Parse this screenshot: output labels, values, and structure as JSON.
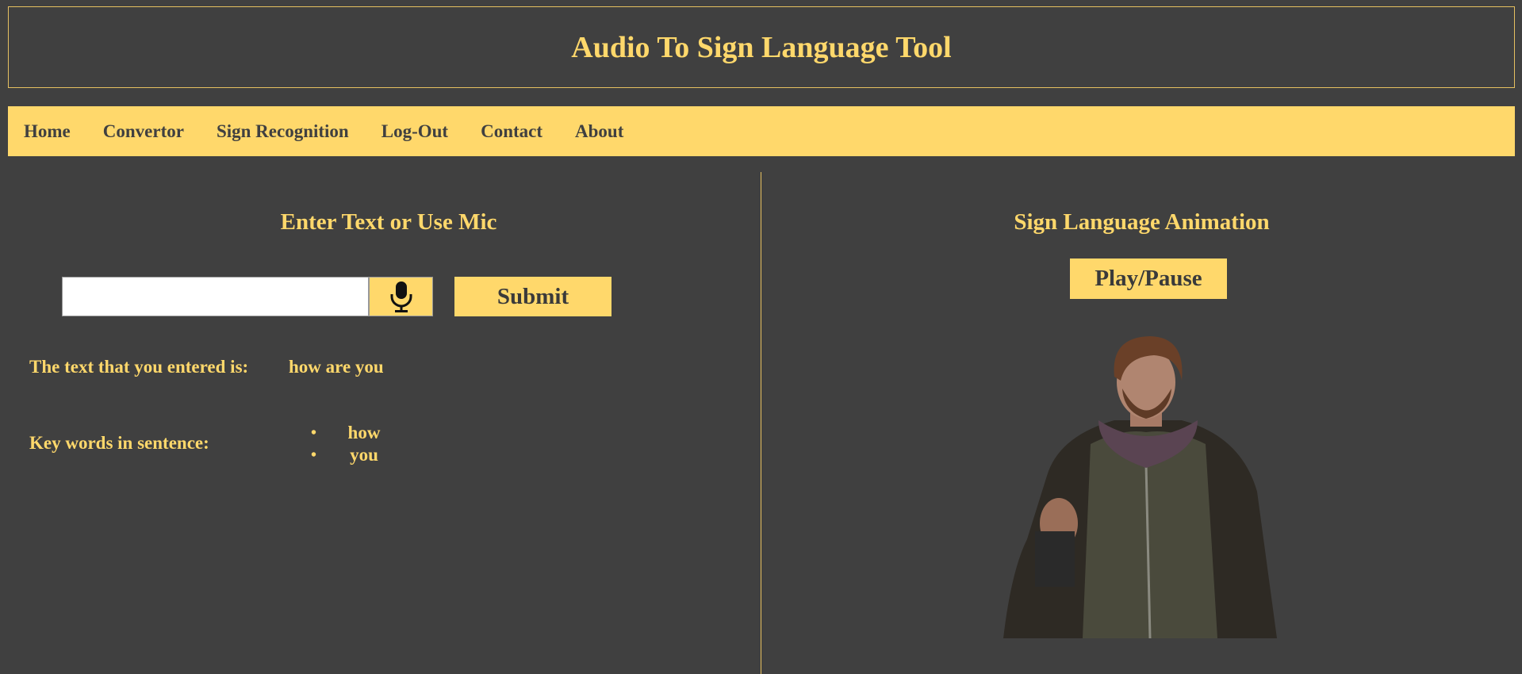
{
  "header": {
    "title": "Audio To Sign Language Tool"
  },
  "nav": {
    "items": [
      {
        "label": "Home"
      },
      {
        "label": "Convertor"
      },
      {
        "label": "Sign Recognition"
      },
      {
        "label": "Log-Out"
      },
      {
        "label": "Contact"
      },
      {
        "label": "About"
      }
    ]
  },
  "left_panel": {
    "heading": "Enter Text or Use Mic",
    "input": {
      "value": "",
      "placeholder": ""
    },
    "mic_icon": "microphone-icon",
    "submit_label": "Submit",
    "entered_label": "The text that you entered is:",
    "entered_value": "how are you",
    "keywords_label": "Key words in sentence:",
    "keywords": [
      "how",
      "you"
    ]
  },
  "right_panel": {
    "heading": "Sign Language Animation",
    "play_label": "Play/Pause"
  },
  "colors": {
    "background": "#404040",
    "accent": "#ffd86b",
    "dark_text": "#404040"
  }
}
